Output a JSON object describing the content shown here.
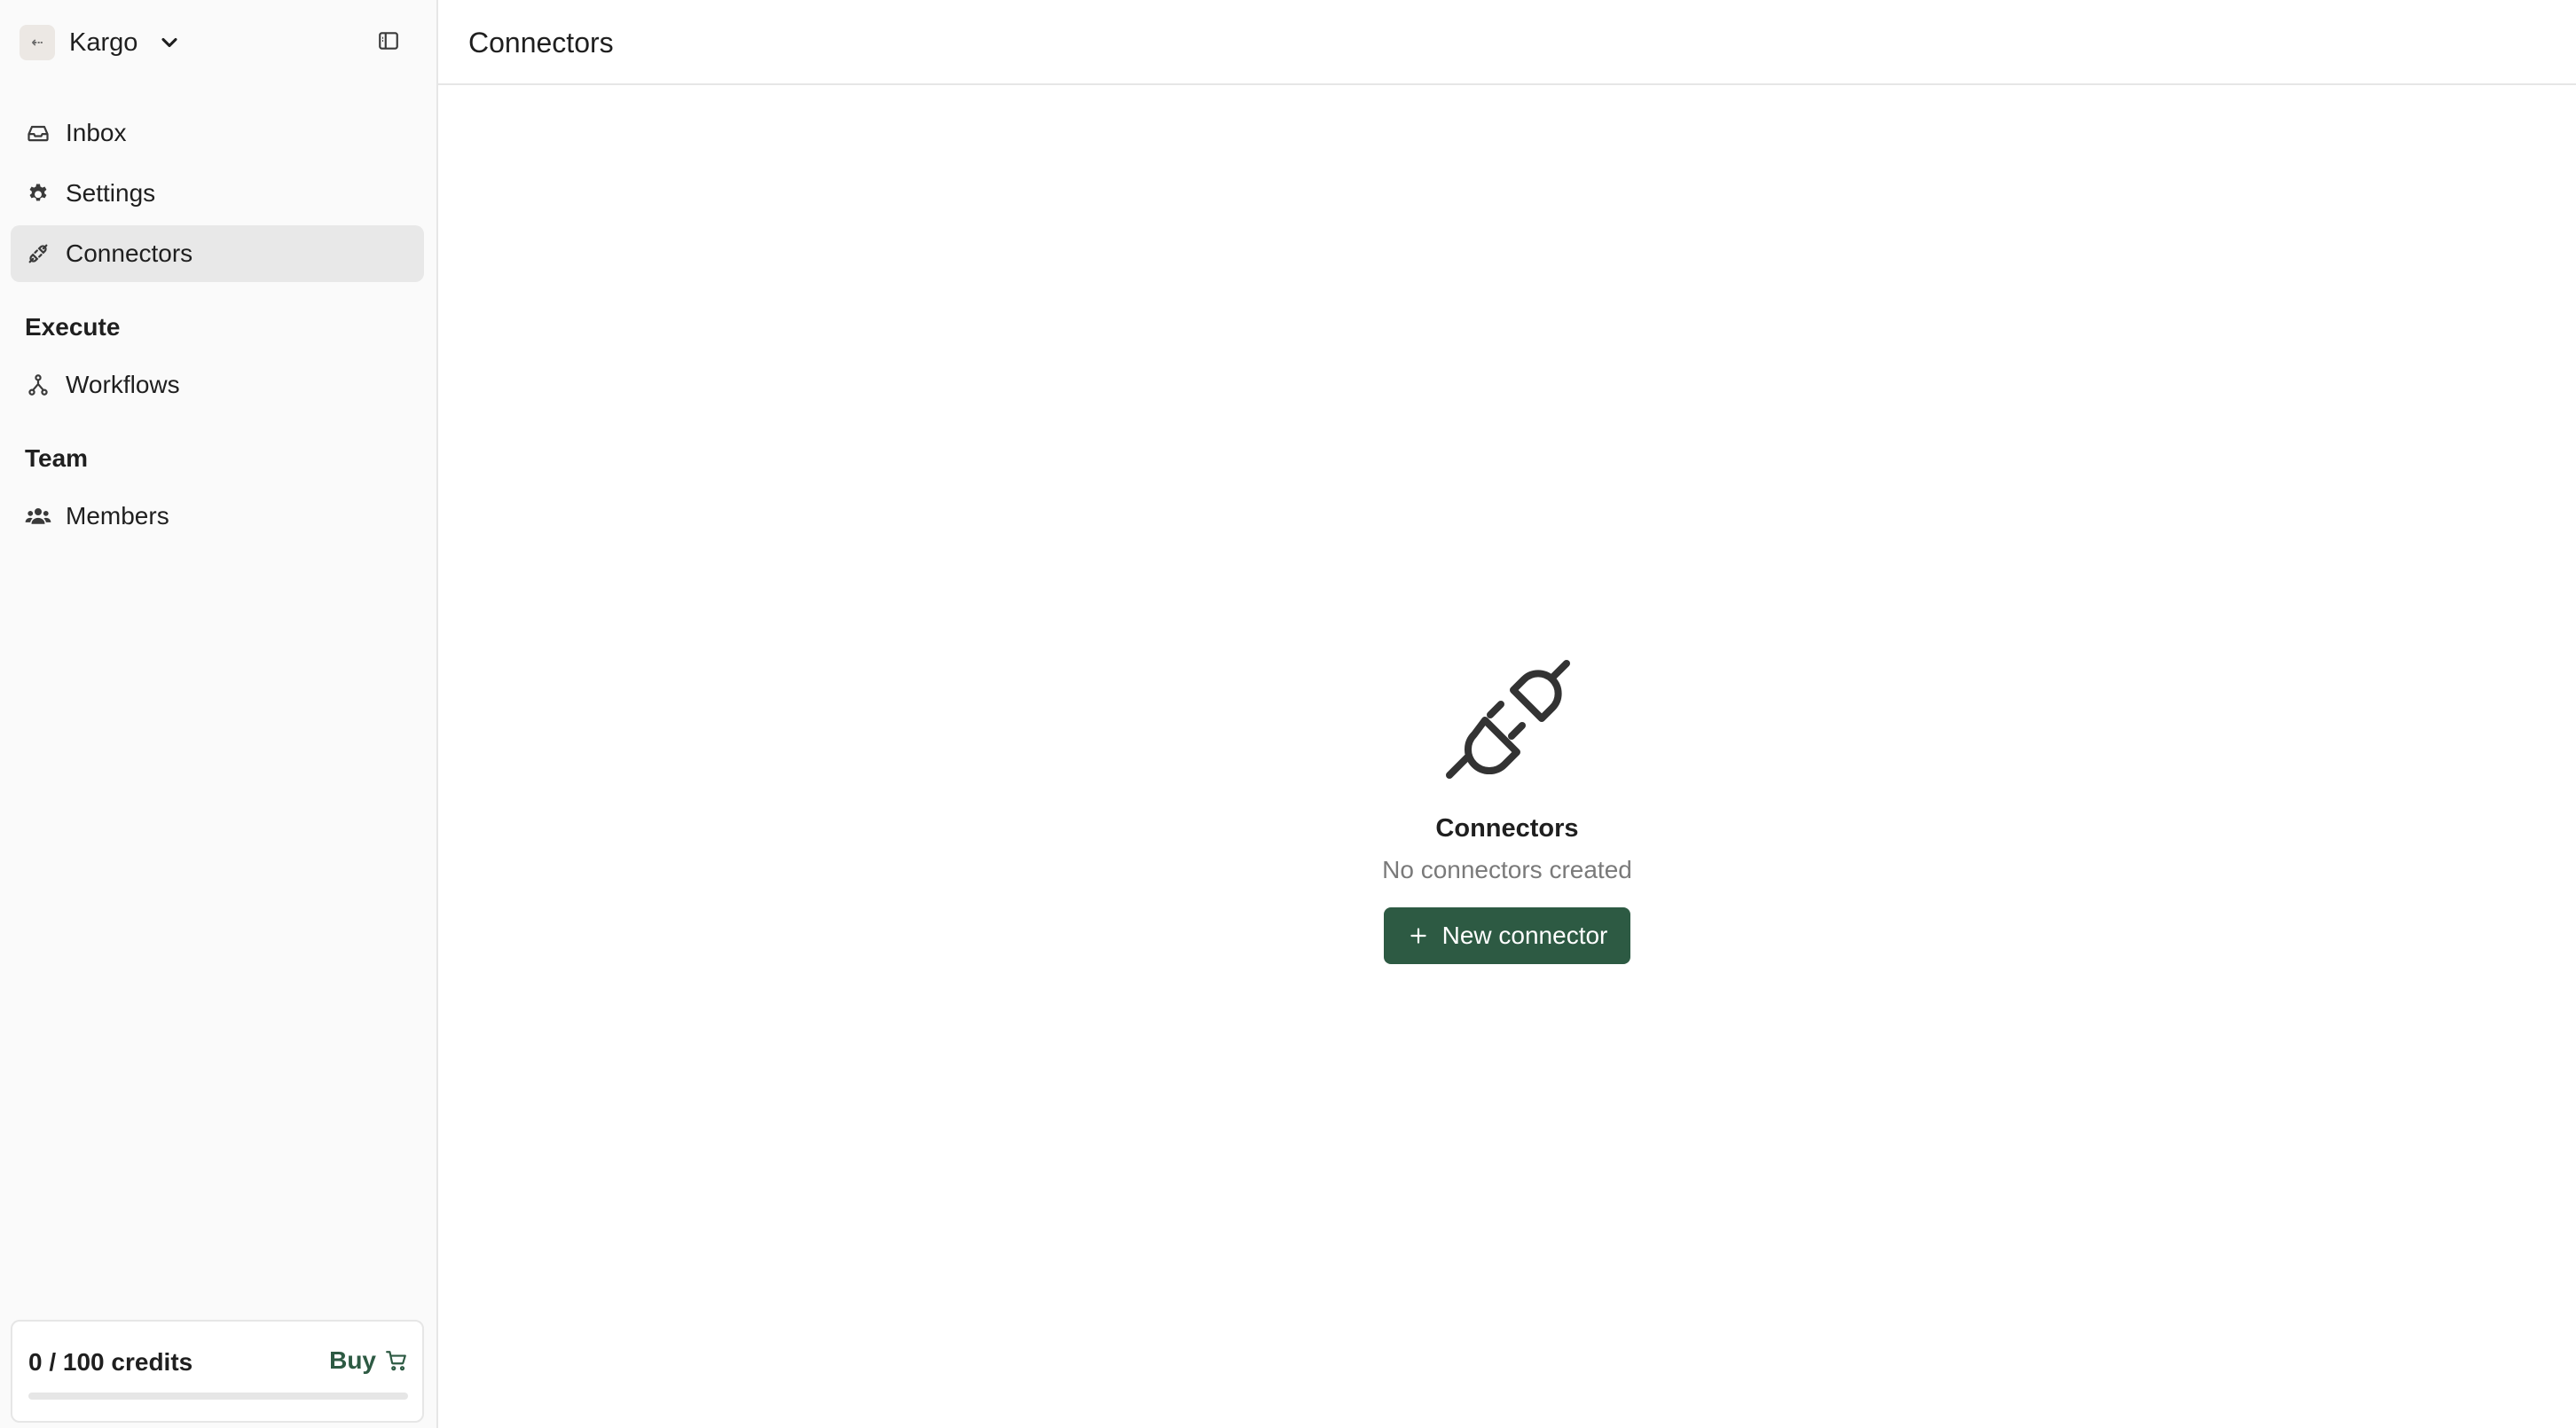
{
  "workspace": {
    "name": "Kargo",
    "avatar_glyph": "⇠"
  },
  "sidebar": {
    "items": [
      {
        "label": "Inbox",
        "icon": "inbox-icon"
      },
      {
        "label": "Settings",
        "icon": "gear-icon"
      },
      {
        "label": "Connectors",
        "icon": "plug-icon",
        "active": true
      }
    ],
    "sections": [
      {
        "title": "Execute",
        "items": [
          {
            "label": "Workflows",
            "icon": "workflow-icon"
          }
        ]
      },
      {
        "title": "Team",
        "items": [
          {
            "label": "Members",
            "icon": "users-icon"
          }
        ]
      }
    ],
    "credits": {
      "text": "0 / 100 credits",
      "used": 0,
      "total": 100,
      "buy_label": "Buy"
    }
  },
  "header": {
    "title": "Connectors"
  },
  "empty_state": {
    "title": "Connectors",
    "subtitle": "No connectors created",
    "button_label": "New connector"
  },
  "colors": {
    "accent": "#2d5a43",
    "active_item_bg": "#e8e8e8",
    "sidebar_bg": "#fafafa"
  }
}
